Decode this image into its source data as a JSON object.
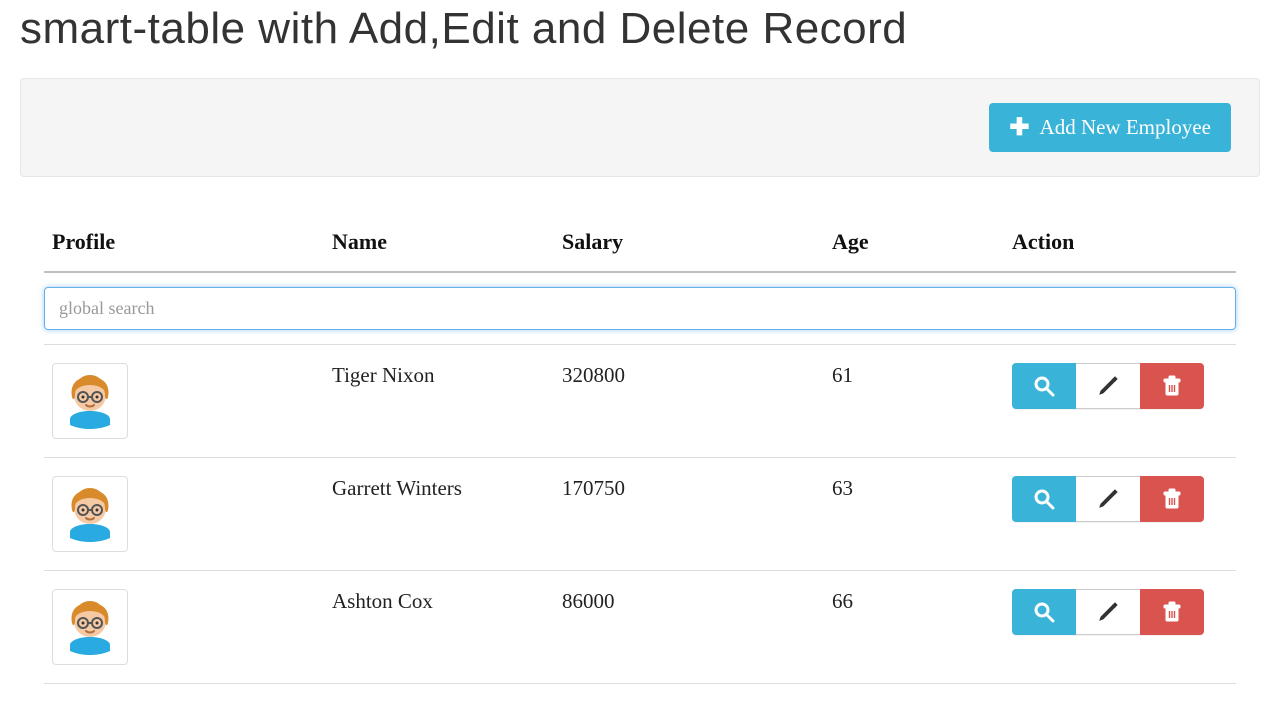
{
  "page": {
    "title": "smart-table with Add,Edit and Delete Record"
  },
  "toolbar": {
    "add_label": "Add New Employee"
  },
  "table": {
    "headers": {
      "profile": "Profile",
      "name": "Name",
      "salary": "Salary",
      "age": "Age",
      "action": "Action"
    },
    "search": {
      "placeholder": "global search",
      "value": ""
    },
    "rows": [
      {
        "name": "Tiger Nixon",
        "salary": "320800",
        "age": "61"
      },
      {
        "name": "Garrett Winters",
        "salary": "170750",
        "age": "63"
      },
      {
        "name": "Ashton Cox",
        "salary": "86000",
        "age": "66"
      }
    ]
  },
  "icons": {
    "plus": "plus-icon",
    "search": "search-icon",
    "edit": "pencil-icon",
    "delete": "trash-icon",
    "avatar": "avatar-icon"
  },
  "colors": {
    "primary": "#39b3d7",
    "danger": "#d9534f",
    "panel_bg": "#f5f5f5",
    "focus_border": "#66afe9"
  }
}
